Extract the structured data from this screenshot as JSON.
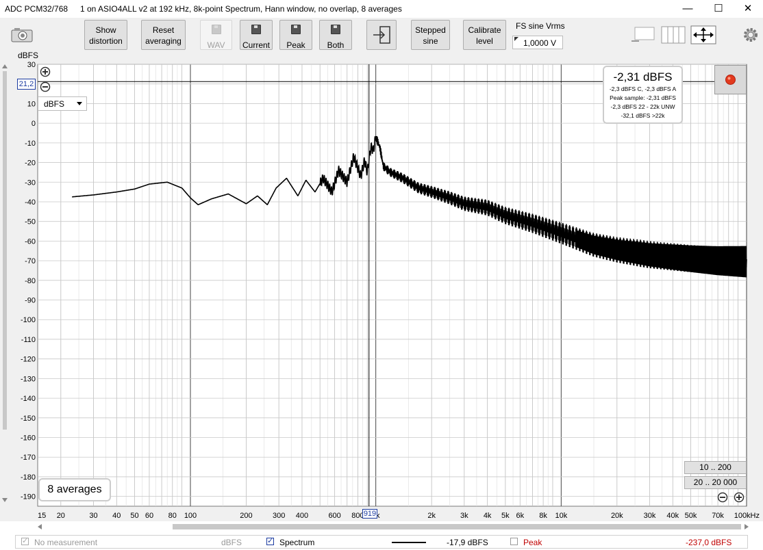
{
  "window": {
    "app_title": "ADC PCM32/768",
    "subtitle": "1 on ASIO4ALL v2 at 192 kHz, 8k-point Spectrum, Hann window, no overlap, 8 averages",
    "minimize": "—",
    "maximize": "☐",
    "close": "✕"
  },
  "toolbar": {
    "show_distortion": "Show distortion",
    "reset_averaging": "Reset averaging",
    "wav": "WAV",
    "current": "Current",
    "peak": "Peak",
    "both": "Both",
    "stepped_sine": "Stepped sine",
    "calibrate_level": "Calibrate level",
    "fs_label": "FS sine Vrms",
    "fs_value": "1,0000 V"
  },
  "plot": {
    "y_unit_label": "dBFS",
    "unit_dropdown": "dBFS",
    "cursor_level": "21,2",
    "cursor_freq": "919",
    "averages_label": "8 averages",
    "range_button_1": "10 .. 200",
    "range_button_2": "20 .. 20 000",
    "readout": {
      "main": "-2,31 dBFS",
      "line1": "-2,3 dBFS C, -2,3 dBFS A",
      "line2": "Peak sample: -2,31 dBFS",
      "line3": "-2,3 dBFS 22 - 22k UNW",
      "line4": "-32,1 dBFS >22k"
    }
  },
  "status": {
    "no_measurement": "No measurement",
    "unit": "dBFS",
    "spectrum": "Spectrum",
    "spectrum_value": "-17,9 dBFS",
    "peak": "Peak",
    "peak_value": "-237,0 dBFS"
  },
  "chart_data": {
    "type": "line",
    "xlabel": "",
    "ylabel": "dBFS",
    "x_scale": "log",
    "xlim": [
      15,
      100000
    ],
    "ylim": [
      -195,
      30
    ],
    "grid": true,
    "x_ticks": [
      "15",
      "20",
      "30",
      "40",
      "50",
      "60",
      "80",
      "100",
      "200",
      "300",
      "400",
      "600",
      "800",
      "1k",
      "2k",
      "3k",
      "4k",
      "5k",
      "6k",
      "8k",
      "10k",
      "20k",
      "30k",
      "40k",
      "50k",
      "70k",
      "100kHz"
    ],
    "y_ticks": [
      "30",
      "20",
      "10",
      "0",
      "-10",
      "-20",
      "-30",
      "-40",
      "-50",
      "-60",
      "-70",
      "-80",
      "-90",
      "-100",
      "-110",
      "-120",
      "-130",
      "-140",
      "-150",
      "-160",
      "-170",
      "-180",
      "-190"
    ],
    "series": [
      {
        "x": [
          23,
          30,
          40,
          50,
          60,
          75,
          90,
          100,
          110,
          130,
          160,
          200,
          230,
          260,
          290,
          330,
          380,
          420,
          470,
          520,
          580,
          630,
          700,
          760,
          830,
          870,
          900,
          940,
          970,
          1000,
          1050,
          1100,
          1200,
          1400,
          1700,
          2000,
          2500,
          3000,
          4000,
          5000,
          7000,
          10000,
          15000,
          20000,
          30000,
          50000,
          70000,
          100000
        ],
        "y": [
          -37.5,
          -36.5,
          -35,
          -33.5,
          -31,
          -30,
          -33,
          -38,
          -41.5,
          -38.5,
          -36,
          -41,
          -37,
          -41.5,
          -33,
          -28,
          -37,
          -29,
          -35,
          -28,
          -35,
          -24,
          -30,
          -17,
          -27,
          -19,
          -25,
          -12,
          -14,
          -7,
          -12,
          -22,
          -25,
          -28,
          -33,
          -35,
          -38,
          -41,
          -43,
          -47,
          -51,
          -56,
          -62,
          -64.5,
          -67,
          -69,
          -70,
          -70.5
        ]
      }
    ]
  }
}
